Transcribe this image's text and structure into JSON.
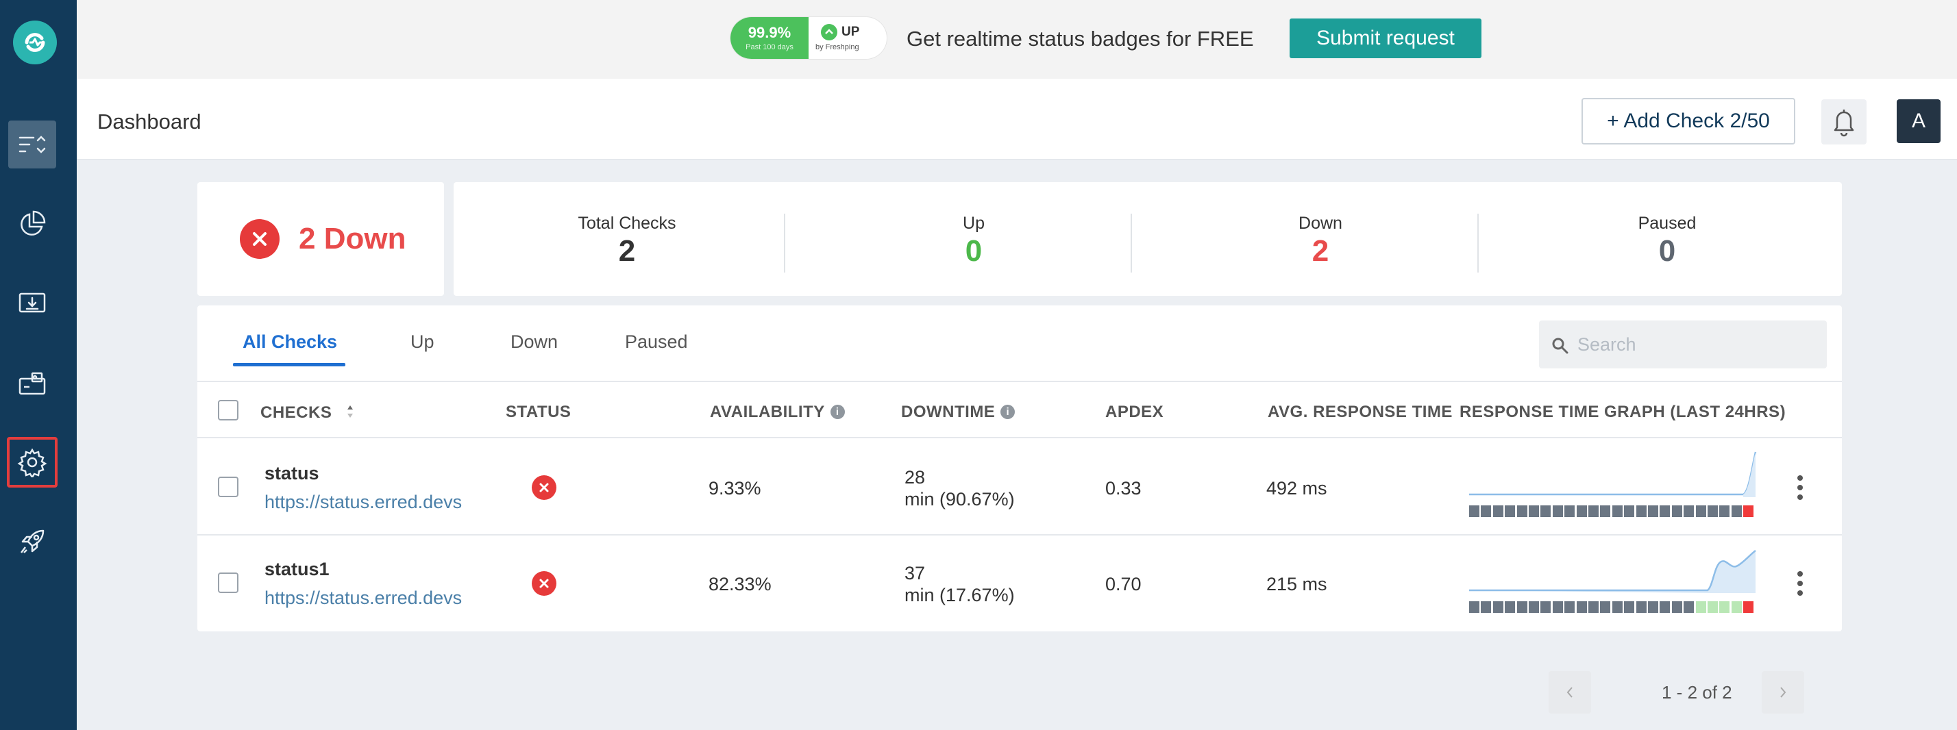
{
  "sidebar": {
    "items": [
      {
        "name": "checks",
        "icon": "list-sort-icon",
        "active": true
      },
      {
        "name": "reports",
        "icon": "pie-chart-icon"
      },
      {
        "name": "status-pages",
        "icon": "monitor-download-icon"
      },
      {
        "name": "integrations",
        "icon": "briefcase-icon"
      },
      {
        "name": "settings",
        "icon": "gear-icon",
        "highlighted": true
      },
      {
        "name": "whats-new",
        "icon": "rocket-icon"
      }
    ]
  },
  "banner": {
    "badge_percent": "99.9%",
    "badge_period": "Past 100 days",
    "badge_state": "UP",
    "badge_by": "by Freshping",
    "text": "Get realtime status badges for FREE",
    "submit_label": "Submit request"
  },
  "header": {
    "title": "Dashboard",
    "add_check_label": "+ Add Check 2/50",
    "avatar_initial": "A"
  },
  "summary": {
    "down_label": "2 Down",
    "stats": [
      {
        "label": "Total Checks",
        "value": "2",
        "color": "#333333"
      },
      {
        "label": "Up",
        "value": "0",
        "color": "#4cb84a"
      },
      {
        "label": "Down",
        "value": "2",
        "color": "#e84b4b"
      },
      {
        "label": "Paused",
        "value": "0",
        "color": "#5e6670"
      }
    ]
  },
  "tabs": [
    "All Checks",
    "Up",
    "Down",
    "Paused"
  ],
  "search": {
    "placeholder": "Search"
  },
  "table": {
    "columns": {
      "checks": "CHECKS",
      "status": "STATUS",
      "availability": "AVAILABILITY",
      "downtime": "DOWNTIME",
      "apdex": "APDEX",
      "avg_response": "AVG. RESPONSE TIME",
      "graph": "RESPONSE TIME GRAPH (LAST 24HRS)"
    },
    "rows": [
      {
        "name": "status",
        "url": "https://status.erred.devs",
        "status": "down",
        "availability": "9.33%",
        "downtime_line1": "28",
        "downtime_line2": "min (90.67%)",
        "apdex": "0.33",
        "avg_response": "492 ms",
        "bars": [
          "g",
          "g",
          "g",
          "g",
          "g",
          "g",
          "g",
          "g",
          "g",
          "g",
          "g",
          "g",
          "g",
          "g",
          "g",
          "g",
          "g",
          "g",
          "g",
          "g",
          "g",
          "g",
          "g",
          "r"
        ]
      },
      {
        "name": "status1",
        "url": "https://status.erred.devs",
        "status": "down",
        "availability": "82.33%",
        "downtime_line1": "37",
        "downtime_line2": "min (17.67%)",
        "apdex": "0.70",
        "avg_response": "215 ms",
        "bars": [
          "g",
          "g",
          "g",
          "g",
          "g",
          "g",
          "g",
          "g",
          "g",
          "g",
          "g",
          "g",
          "g",
          "g",
          "g",
          "g",
          "g",
          "g",
          "g",
          "l",
          "l",
          "l",
          "l",
          "r"
        ]
      }
    ]
  },
  "pagination": {
    "text": "1 - 2 of 2"
  },
  "colors": {
    "accent": "#1f6fd1",
    "sidebar": "#123a5a",
    "down": "#e63a3a",
    "up": "#4cc15c",
    "teal": "#1c9e98"
  }
}
